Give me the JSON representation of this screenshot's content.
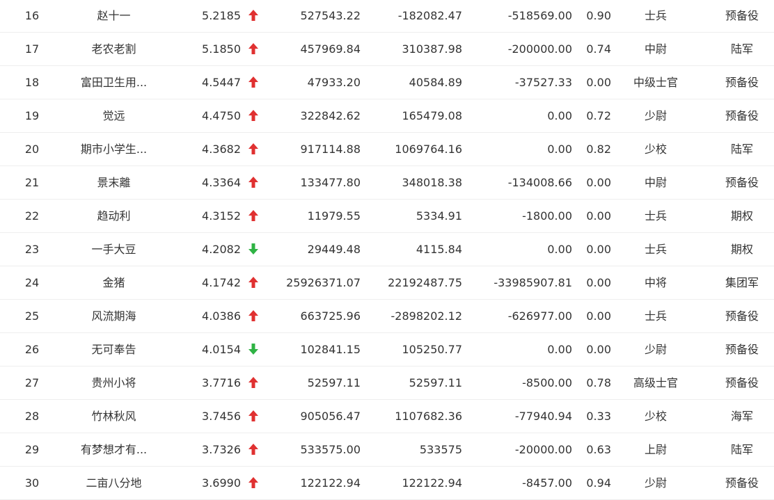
{
  "colors": {
    "up": "#e03131",
    "down": "#2fb344",
    "text": "#333333",
    "divider": "#eeeeee"
  },
  "rows": [
    {
      "rank": "16",
      "name": "赵十一",
      "score": "5.2185",
      "trend": "up",
      "trend_icon": "arrow-up-icon",
      "v1": "527543.22",
      "v2": "-182082.47",
      "v3": "-518569.00",
      "ratio": "0.90",
      "military_rank": "士兵",
      "corps": "预备役"
    },
    {
      "rank": "17",
      "name": "老农老割",
      "score": "5.1850",
      "trend": "up",
      "trend_icon": "arrow-up-icon",
      "v1": "457969.84",
      "v2": "310387.98",
      "v3": "-200000.00",
      "ratio": "0.74",
      "military_rank": "中尉",
      "corps": "陆军"
    },
    {
      "rank": "18",
      "name": "富田卫生用...",
      "score": "4.5447",
      "trend": "up",
      "trend_icon": "arrow-up-icon",
      "v1": "47933.20",
      "v2": "40584.89",
      "v3": "-37527.33",
      "ratio": "0.00",
      "military_rank": "中级士官",
      "corps": "预备役"
    },
    {
      "rank": "19",
      "name": "觉远",
      "score": "4.4750",
      "trend": "up",
      "trend_icon": "arrow-up-icon",
      "v1": "322842.62",
      "v2": "165479.08",
      "v3": "0.00",
      "ratio": "0.72",
      "military_rank": "少尉",
      "corps": "预备役"
    },
    {
      "rank": "20",
      "name": "期市小学生...",
      "score": "4.3682",
      "trend": "up",
      "trend_icon": "arrow-up-icon",
      "v1": "917114.88",
      "v2": "1069764.16",
      "v3": "0.00",
      "ratio": "0.82",
      "military_rank": "少校",
      "corps": "陆军"
    },
    {
      "rank": "21",
      "name": "景末離",
      "score": "4.3364",
      "trend": "up",
      "trend_icon": "arrow-up-icon",
      "v1": "133477.80",
      "v2": "348018.38",
      "v3": "-134008.66",
      "ratio": "0.00",
      "military_rank": "中尉",
      "corps": "预备役"
    },
    {
      "rank": "22",
      "name": "趋动利",
      "score": "4.3152",
      "trend": "up",
      "trend_icon": "arrow-up-icon",
      "v1": "11979.55",
      "v2": "5334.91",
      "v3": "-1800.00",
      "ratio": "0.00",
      "military_rank": "士兵",
      "corps": "期权"
    },
    {
      "rank": "23",
      "name": "一手大豆",
      "score": "4.2082",
      "trend": "down",
      "trend_icon": "arrow-down-icon",
      "v1": "29449.48",
      "v2": "4115.84",
      "v3": "0.00",
      "ratio": "0.00",
      "military_rank": "士兵",
      "corps": "期权"
    },
    {
      "rank": "24",
      "name": "金猪",
      "score": "4.1742",
      "trend": "up",
      "trend_icon": "arrow-up-icon",
      "v1": "25926371.07",
      "v2": "22192487.75",
      "v3": "-33985907.81",
      "ratio": "0.00",
      "military_rank": "中将",
      "corps": "集团军"
    },
    {
      "rank": "25",
      "name": "风流期海",
      "score": "4.0386",
      "trend": "up",
      "trend_icon": "arrow-up-icon",
      "v1": "663725.96",
      "v2": "-2898202.12",
      "v3": "-626977.00",
      "ratio": "0.00",
      "military_rank": "士兵",
      "corps": "预备役"
    },
    {
      "rank": "26",
      "name": "无可奉告",
      "score": "4.0154",
      "trend": "down",
      "trend_icon": "arrow-down-icon",
      "v1": "102841.15",
      "v2": "105250.77",
      "v3": "0.00",
      "ratio": "0.00",
      "military_rank": "少尉",
      "corps": "预备役"
    },
    {
      "rank": "27",
      "name": "贵州小将",
      "score": "3.7716",
      "trend": "up",
      "trend_icon": "arrow-up-icon",
      "v1": "52597.11",
      "v2": "52597.11",
      "v3": "-8500.00",
      "ratio": "0.78",
      "military_rank": "高级士官",
      "corps": "预备役"
    },
    {
      "rank": "28",
      "name": "竹林秋风",
      "score": "3.7456",
      "trend": "up",
      "trend_icon": "arrow-up-icon",
      "v1": "905056.47",
      "v2": "1107682.36",
      "v3": "-77940.94",
      "ratio": "0.33",
      "military_rank": "少校",
      "corps": "海军"
    },
    {
      "rank": "29",
      "name": "有梦想才有...",
      "score": "3.7326",
      "trend": "up",
      "trend_icon": "arrow-up-icon",
      "v1": "533575.00",
      "v2": "533575",
      "v3": "-20000.00",
      "ratio": "0.63",
      "military_rank": "上尉",
      "corps": "陆军"
    },
    {
      "rank": "30",
      "name": "二亩八分地",
      "score": "3.6990",
      "trend": "up",
      "trend_icon": "arrow-up-icon",
      "v1": "122122.94",
      "v2": "122122.94",
      "v3": "-8457.00",
      "ratio": "0.94",
      "military_rank": "少尉",
      "corps": "预备役"
    }
  ]
}
